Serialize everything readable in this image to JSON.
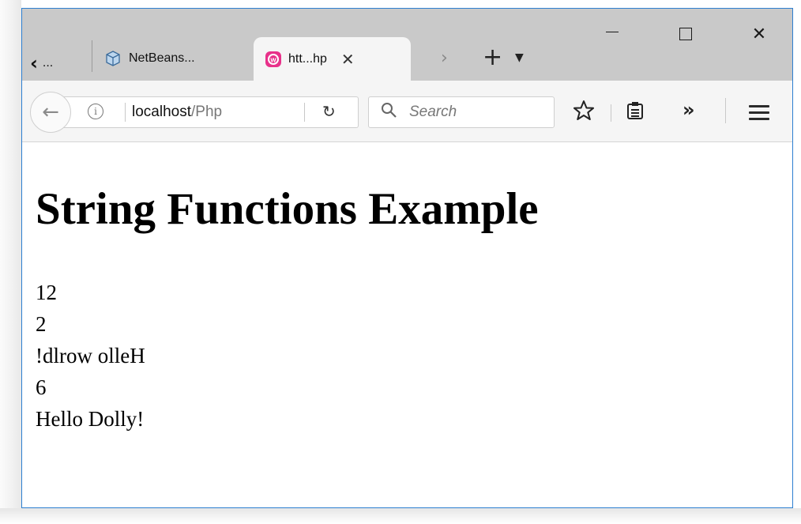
{
  "browser": {
    "tabs": [
      {
        "label": "...",
        "state": "overflow-left"
      },
      {
        "label": "NetBeans...",
        "icon": "netbeans-cube-icon"
      },
      {
        "label": "htt...hp",
        "icon": "wamp-icon",
        "active": true
      }
    ],
    "address_bar": {
      "host": "localhost",
      "path": "/Php"
    },
    "search": {
      "placeholder": "Search"
    }
  },
  "page": {
    "heading": "String Functions Example",
    "output_lines": [
      "12",
      "2",
      "!dlrow olleH",
      "6",
      "Hello Dolly!"
    ]
  },
  "colors": {
    "titlebar": "#c9c9c9",
    "toolbar": "#f5f5f5",
    "window_border": "#2d7fd1",
    "wamp_icon": "#e8318a"
  }
}
